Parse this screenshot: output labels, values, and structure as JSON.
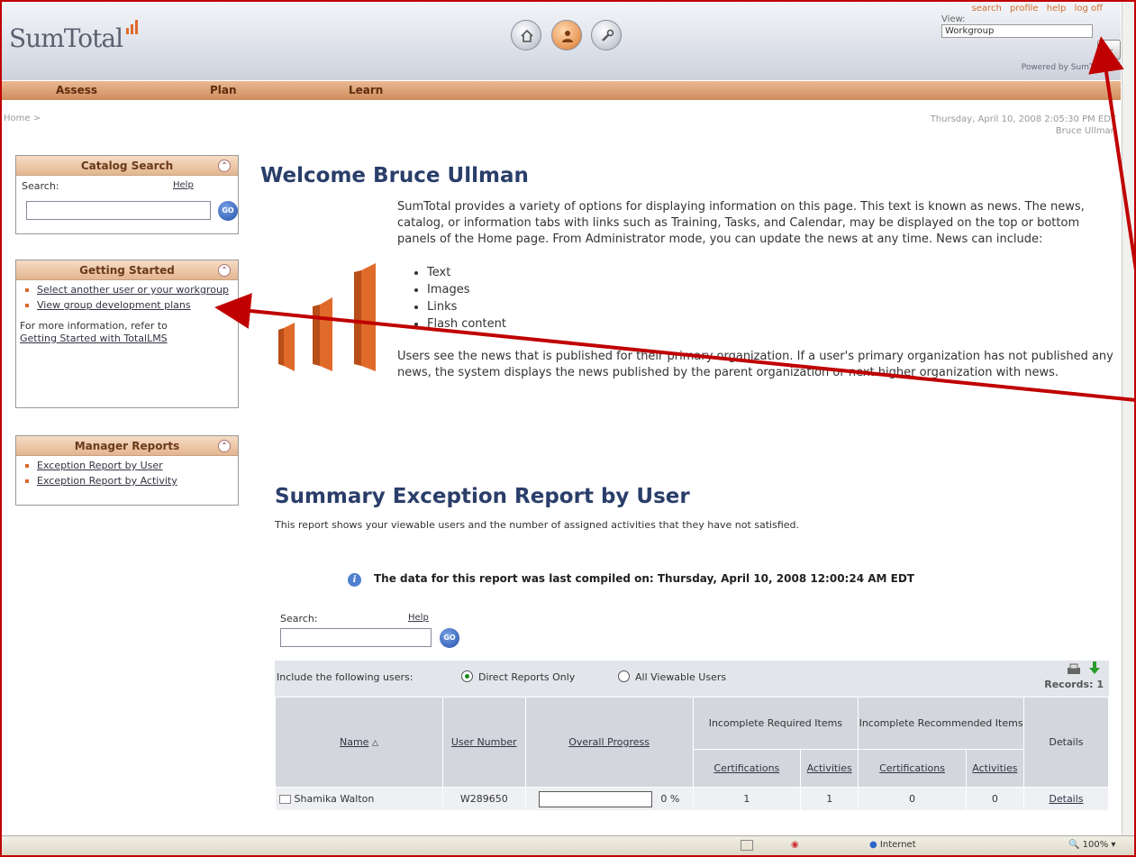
{
  "header": {
    "logo": "SumTotal",
    "top_links": [
      "search",
      "profile",
      "help",
      "log off"
    ],
    "view_label": "View:",
    "view_value": "Workgroup",
    "view_button": "...",
    "powered_by": "Powered by SumTotal",
    "icons": [
      "home-icon",
      "user-icon",
      "tools-icon"
    ]
  },
  "nav": {
    "items": [
      "Assess",
      "Plan",
      "Learn"
    ]
  },
  "breadcrumb": "Home >",
  "datetime": "Thursday, April 10, 2008 2:05:30 PM EDT",
  "user_name": "Bruce Ullman",
  "catalog_search": {
    "title": "Catalog Search",
    "label": "Search:",
    "help": "Help",
    "go": "GO"
  },
  "getting_started": {
    "title": "Getting Started",
    "links": [
      "Select another user or your workgroup",
      "View group development plans"
    ],
    "note": "For more information, refer to",
    "note_link": "Getting Started with TotalLMS"
  },
  "manager_reports": {
    "title": "Manager Reports",
    "links": [
      "Exception Report by User",
      "Exception Report by Activity"
    ]
  },
  "welcome": {
    "title": "Welcome Bruce Ullman",
    "para1": "SumTotal provides a variety of options for displaying information on this page. This text is known as news. The news, catalog, or information tabs with links such as Training, Tasks, and Calendar, may be displayed on the top or bottom panels of the Home page. From Administrator mode, you can update the news at any time. News can include:",
    "bullets": [
      "Text",
      "Images",
      "Links",
      "Flash content"
    ],
    "para2": "Users see the news that is published for their primary organization. If a user's primary organization has not published any news, the system displays the news published by the parent organization or next higher organization with news."
  },
  "report": {
    "title": "Summary Exception Report by User",
    "description": "This report shows your viewable users and the number of assigned activities that they have not satisfied.",
    "compiled": "The data for this report was last compiled on: Thursday, April 10, 2008 12:00:24 AM EDT",
    "search_label": "Search:",
    "search_help": "Help",
    "go": "GO",
    "filter_label": "Include the following users:",
    "option_direct": "Direct Reports Only",
    "option_all": "All Viewable Users",
    "records": "Records: 1",
    "group_required": "Incomplete Required Items",
    "group_recommended": "Incomplete Recommended Items",
    "columns": {
      "name": "Name",
      "user_number": "User Number",
      "overall_progress": "Overall Progress",
      "req_cert": "Certifications",
      "req_act": "Activities",
      "rec_cert": "Certifications",
      "rec_act": "Activities",
      "details": "Details"
    },
    "rows": [
      {
        "name": "Shamika Walton",
        "user_number": "W289650",
        "progress": 0,
        "progress_text": "0 %",
        "req_cert": "1",
        "req_act": "1",
        "rec_cert": "0",
        "rec_act": "0",
        "details": "Details"
      }
    ]
  },
  "statusbar": {
    "zone": "Internet",
    "zoom": "100%"
  },
  "colors": {
    "accent": "#d26b2a",
    "nav": "#cf8c5c",
    "title": "#2a3e6a",
    "annotation": "#c00000"
  }
}
